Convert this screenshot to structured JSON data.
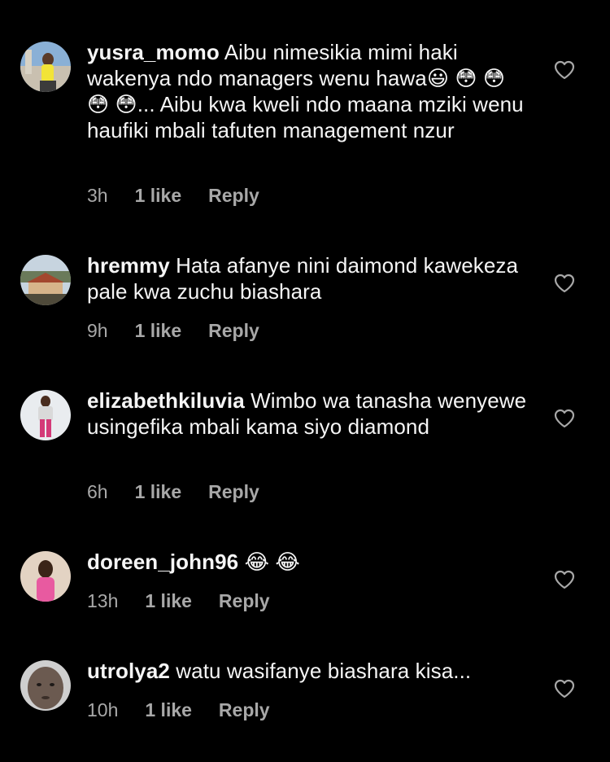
{
  "comments": [
    {
      "username": "yusra_momo",
      "text": "Aibu nimesikia mimi haki wakenya ndo managers wenu hawa😃 😳 😳 😳 😳... Aibu kwa kweli ndo maana mziki wenu haufiki mbali tafuten management nzur",
      "time": "3h",
      "likes": "1 like",
      "reply": "Reply"
    },
    {
      "username": "hremmy",
      "text": "Hata afanye nini daimond kawekeza pale kwa zuchu biashara",
      "time": "9h",
      "likes": "1 like",
      "reply": "Reply"
    },
    {
      "username": "elizabethkiluvia",
      "text": "Wimbo wa tanasha wenyewe usingefika mbali kama siyo diamond",
      "time": "6h",
      "likes": "1 like",
      "reply": "Reply"
    },
    {
      "username": "doreen_john96",
      "text": "😂 😂",
      "time": "13h",
      "likes": "1 like",
      "reply": "Reply"
    },
    {
      "username": "utrolya2",
      "text": "watu wasifanye biashara kisa...",
      "time": "10h",
      "likes": "1 like",
      "reply": "Reply"
    }
  ],
  "icons": {
    "like": "heart-outline-icon"
  },
  "colors": {
    "background": "#000000",
    "text": "#f5f5f5",
    "meta": "#a8a8a8"
  }
}
